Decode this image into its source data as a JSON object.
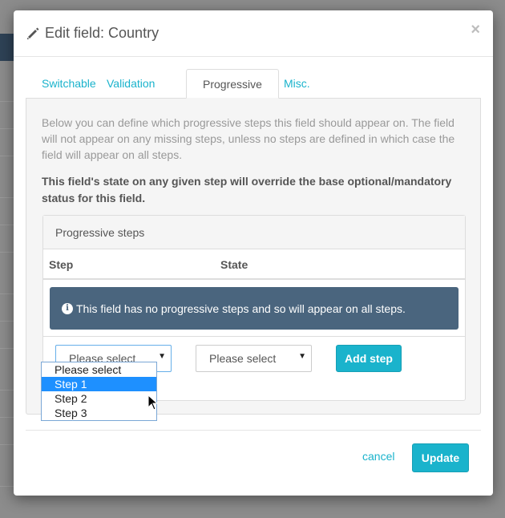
{
  "modal": {
    "title": "Edit field: Country",
    "close_glyph": "×"
  },
  "tabs": [
    {
      "label": "Switchable",
      "active": false
    },
    {
      "label": "Validation",
      "active": false
    },
    {
      "label": "Progressive",
      "active": true
    },
    {
      "label": "Misc.",
      "active": false
    }
  ],
  "panel": {
    "description": "Below you can define which progressive steps this field should appear on. The field will not appear on any missing steps, unless no steps are defined in which case the field will appear on all steps.",
    "warning": "This field's state on any given step will override the base optional/mandatory status for this field."
  },
  "steps_panel": {
    "heading": "Progressive steps",
    "columns": [
      "Step",
      "State"
    ],
    "alert_text": "This field has no progressive steps and so will appear on all steps.",
    "step_select": {
      "value": "Please select",
      "options": [
        "Please select",
        "Step 1",
        "Step 2",
        "Step 3"
      ],
      "highlighted": "Step 1"
    },
    "state_select": {
      "value": "Please select"
    },
    "add_button": "Add step"
  },
  "footer": {
    "cancel": "cancel",
    "update": "Update"
  },
  "colors": {
    "accent": "#1ab3cc",
    "alert_bg": "#4a657e",
    "highlight": "#1e90ff"
  }
}
